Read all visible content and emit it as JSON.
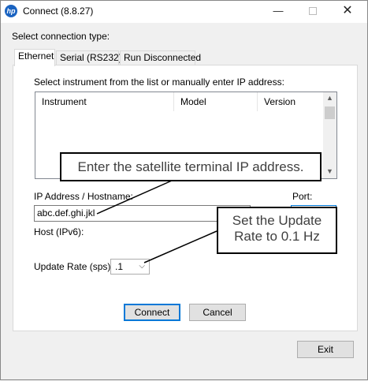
{
  "window": {
    "app_icon": "hp-logo-icon",
    "title": "Connect (8.8.27)",
    "controls": {
      "minimize": "—",
      "close": "✕"
    }
  },
  "connection_type_label": "Select connection type:",
  "tabs": [
    {
      "label": "Ethernet",
      "active": true
    },
    {
      "label": "Serial (RS232)",
      "active": false
    },
    {
      "label": "Run Disconnected",
      "active": false
    }
  ],
  "instrument_prompt": "Select instrument from the list or manually enter IP address:",
  "instrument_list": {
    "columns": [
      "Instrument",
      "Model",
      "Version"
    ],
    "rows": []
  },
  "ip_address": {
    "label": "IP Address / Hostname:",
    "value": "abc.def.ghi.jkl"
  },
  "port": {
    "label": "Port:"
  },
  "host_ipv6": {
    "label": "Host (IPv6):"
  },
  "update_rate": {
    "label": "Update Rate (sps):",
    "selected": ".1"
  },
  "buttons": {
    "connect": "Connect",
    "cancel": "Cancel",
    "exit": "Exit"
  },
  "callouts": {
    "ip": "Enter the satellite terminal IP address.",
    "rate_line1": "Set the Update",
    "rate_line2": "Rate to 0.1 Hz"
  }
}
